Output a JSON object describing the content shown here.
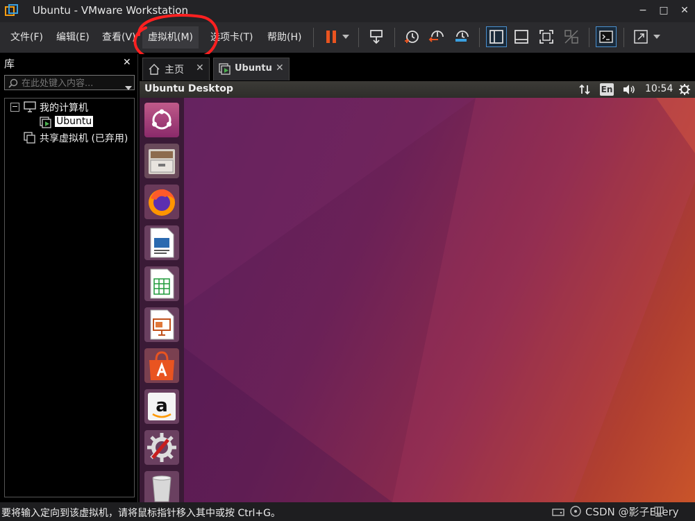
{
  "window": {
    "title": "Ubuntu - VMware Workstation",
    "minimize_label": "−",
    "maximize_label": "□",
    "close_label": "✕"
  },
  "menu": {
    "items": [
      "文件(F)",
      "编辑(E)",
      "查看(V)",
      "虚拟机(M)",
      "选项卡(T)",
      "帮助(H)"
    ]
  },
  "library": {
    "title": "库",
    "close_label": "✕",
    "search_placeholder": "在此处键入内容...",
    "tree": {
      "collapse_label": "−",
      "root_label": "我的计算机",
      "vm_label": "Ubuntu",
      "shared_label": "共享虚拟机 (已弃用)"
    }
  },
  "tabs": [
    {
      "label": "主页"
    },
    {
      "label": "Ubuntu"
    }
  ],
  "tab_close_label": "✕",
  "ubuntu": {
    "panel_title": "Ubuntu Desktop",
    "keyboard_layout": "En",
    "time": "10:54",
    "launcher": [
      "ubuntu-dash-icon",
      "files-icon",
      "firefox-icon",
      "writer-icon",
      "calc-icon",
      "impress-icon",
      "software-center-icon",
      "amazon-icon",
      "settings-icon",
      "trash-icon"
    ]
  },
  "colors": {
    "accent_orange": "#e95420",
    "annotation_red": "#ff2020"
  },
  "status": {
    "hint": "要将输入定向到该虚拟机，请将鼠标指针移入其中或按 Ctrl+G。",
    "watermark": "CSDN @影子Ellery"
  }
}
